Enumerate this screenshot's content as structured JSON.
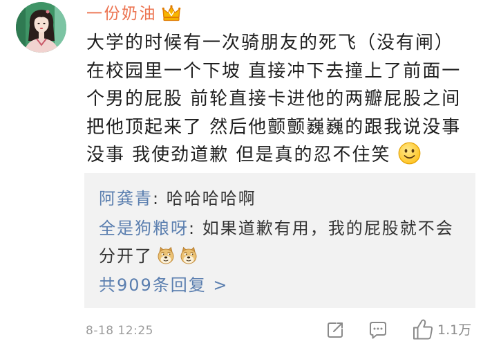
{
  "comment": {
    "avatar_icon": "user-avatar",
    "username": "一份奶油",
    "badge_icon": "crown-icon",
    "text_lines": [
      "大学的时候有一次骑朋友的死飞（没有闸）",
      "在校园里一个下坡 直接冲下去撞上了前面一",
      "个男的屁股 前轮直接卡进他的两瓣屁股之间",
      "把他顶起来了 然后他颤颤巍巍的跟我说没事",
      "没事 我使劲道歉 但是真的忍不住笑"
    ],
    "trailing_emoji_icon": "smile-emoji-icon"
  },
  "replies": {
    "items": [
      {
        "author": "阿龚青",
        "separator": ": ",
        "text": "哈哈哈哈啊"
      },
      {
        "author": "全是狗粮呀",
        "separator": ": ",
        "text_lines": [
          "如果道歉有用，我的屁股就不会",
          "分开了"
        ],
        "emoji_icons": [
          "doge-emoji-icon",
          "doge-emoji-icon"
        ]
      }
    ],
    "more_label": "共909条回复 >"
  },
  "footer": {
    "timestamp": "8-18 12:25",
    "share_icon": "share-icon",
    "comment_icon": "comment-icon",
    "like_icon": "thumbs-up-icon",
    "like_count": "1.1万"
  },
  "colors": {
    "username": "#ec7350",
    "link": "#5a7eaf",
    "text": "#1e1e1e",
    "reply_text": "#333333",
    "meta": "#9b9b9b",
    "icon": "#8a8a8a",
    "reply_background": "#f2f2f2",
    "page_background": "#ffffff"
  }
}
